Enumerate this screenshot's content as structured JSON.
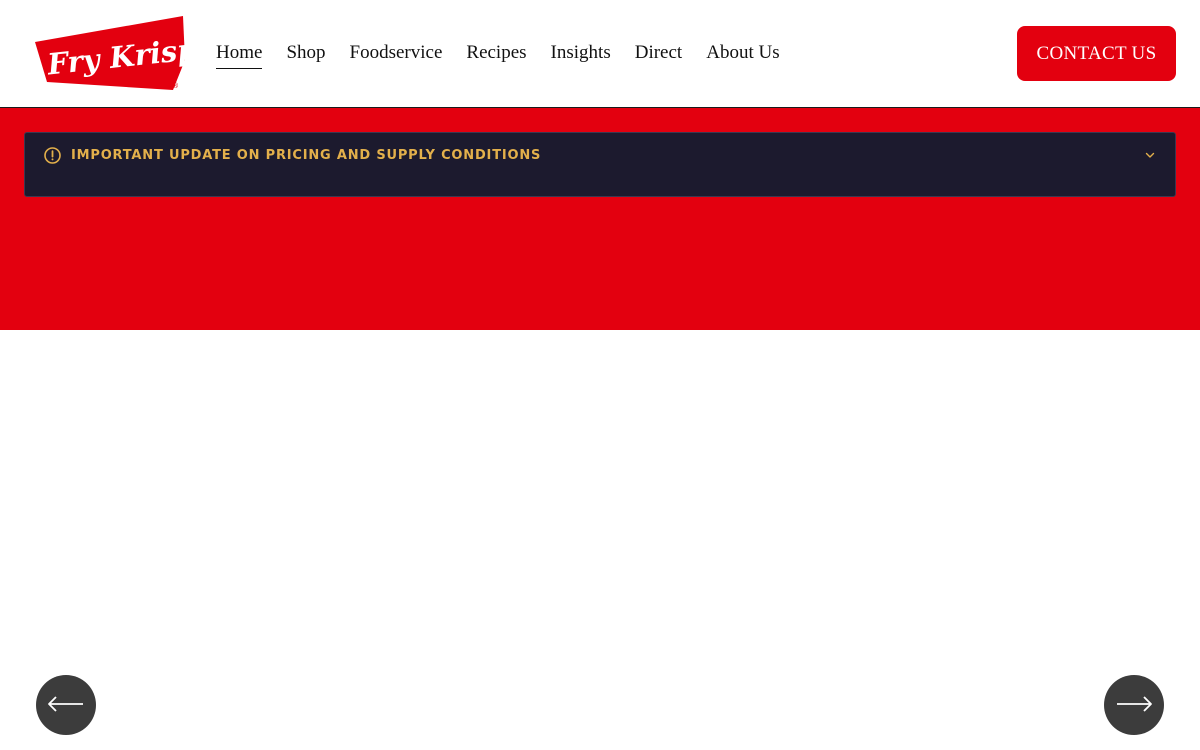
{
  "logo": {
    "text": "Fry Krisp",
    "registered_mark": "®",
    "color": "#e3000f"
  },
  "nav": {
    "items": [
      {
        "label": "Home",
        "active": true
      },
      {
        "label": "Shop",
        "active": false
      },
      {
        "label": "Foodservice",
        "active": false
      },
      {
        "label": "Recipes",
        "active": false
      },
      {
        "label": "Insights",
        "active": false
      },
      {
        "label": "Direct",
        "active": false
      },
      {
        "label": "About Us",
        "active": false
      }
    ]
  },
  "header": {
    "contact_label": "CONTACT US"
  },
  "banner": {
    "background_color": "#e3000f",
    "alert": {
      "icon": "alert-circle-icon",
      "text": "IMPORTANT UPDATE ON PRICING AND SUPPLY CONDITIONS",
      "text_color": "#e3b04b",
      "background_color": "#1c1a2e",
      "toggle_icon": "chevron-down-icon"
    }
  },
  "carousel": {
    "prev_icon": "arrow-left-icon",
    "next_icon": "arrow-right-icon"
  }
}
